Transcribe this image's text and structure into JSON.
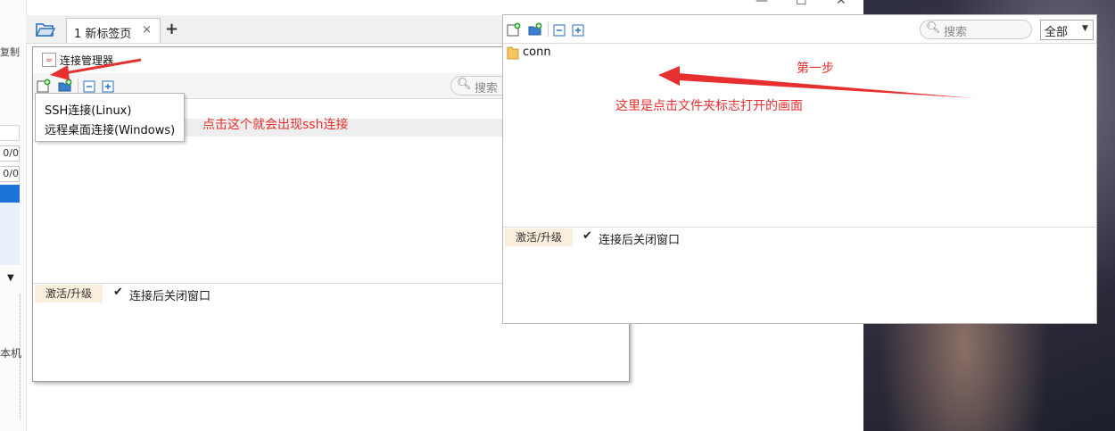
{
  "left_app": {
    "copy_label": "复制",
    "field1": "0/0",
    "field2": "0/0",
    "local_label": "本机"
  },
  "tab": {
    "title": "1 新标签页",
    "close": "×",
    "add": "+"
  },
  "window_buttons": {
    "minimize": "—",
    "maximize": "☐",
    "close": "✕"
  },
  "conn_manager": {
    "title": "连接管理器",
    "search_placeholder": "搜索",
    "menu": [
      "SSH连接(Linux)",
      "远程桌面连接(Windows)"
    ],
    "footer_activate": "激活/升级",
    "footer_checkbox": "连接后关闭窗口"
  },
  "folder_dialog": {
    "search_placeholder": "搜索",
    "filter_value": "全部",
    "folder_name": "conn",
    "footer_activate": "激活/升级",
    "footer_checkbox": "连接后关闭窗口"
  },
  "annotations": {
    "ssh_hint": "点击这个就会出现ssh连接",
    "step1": "第一步",
    "folder_hint": "这里是点击文件夹标志打开的画面",
    "color": "#e63030"
  }
}
